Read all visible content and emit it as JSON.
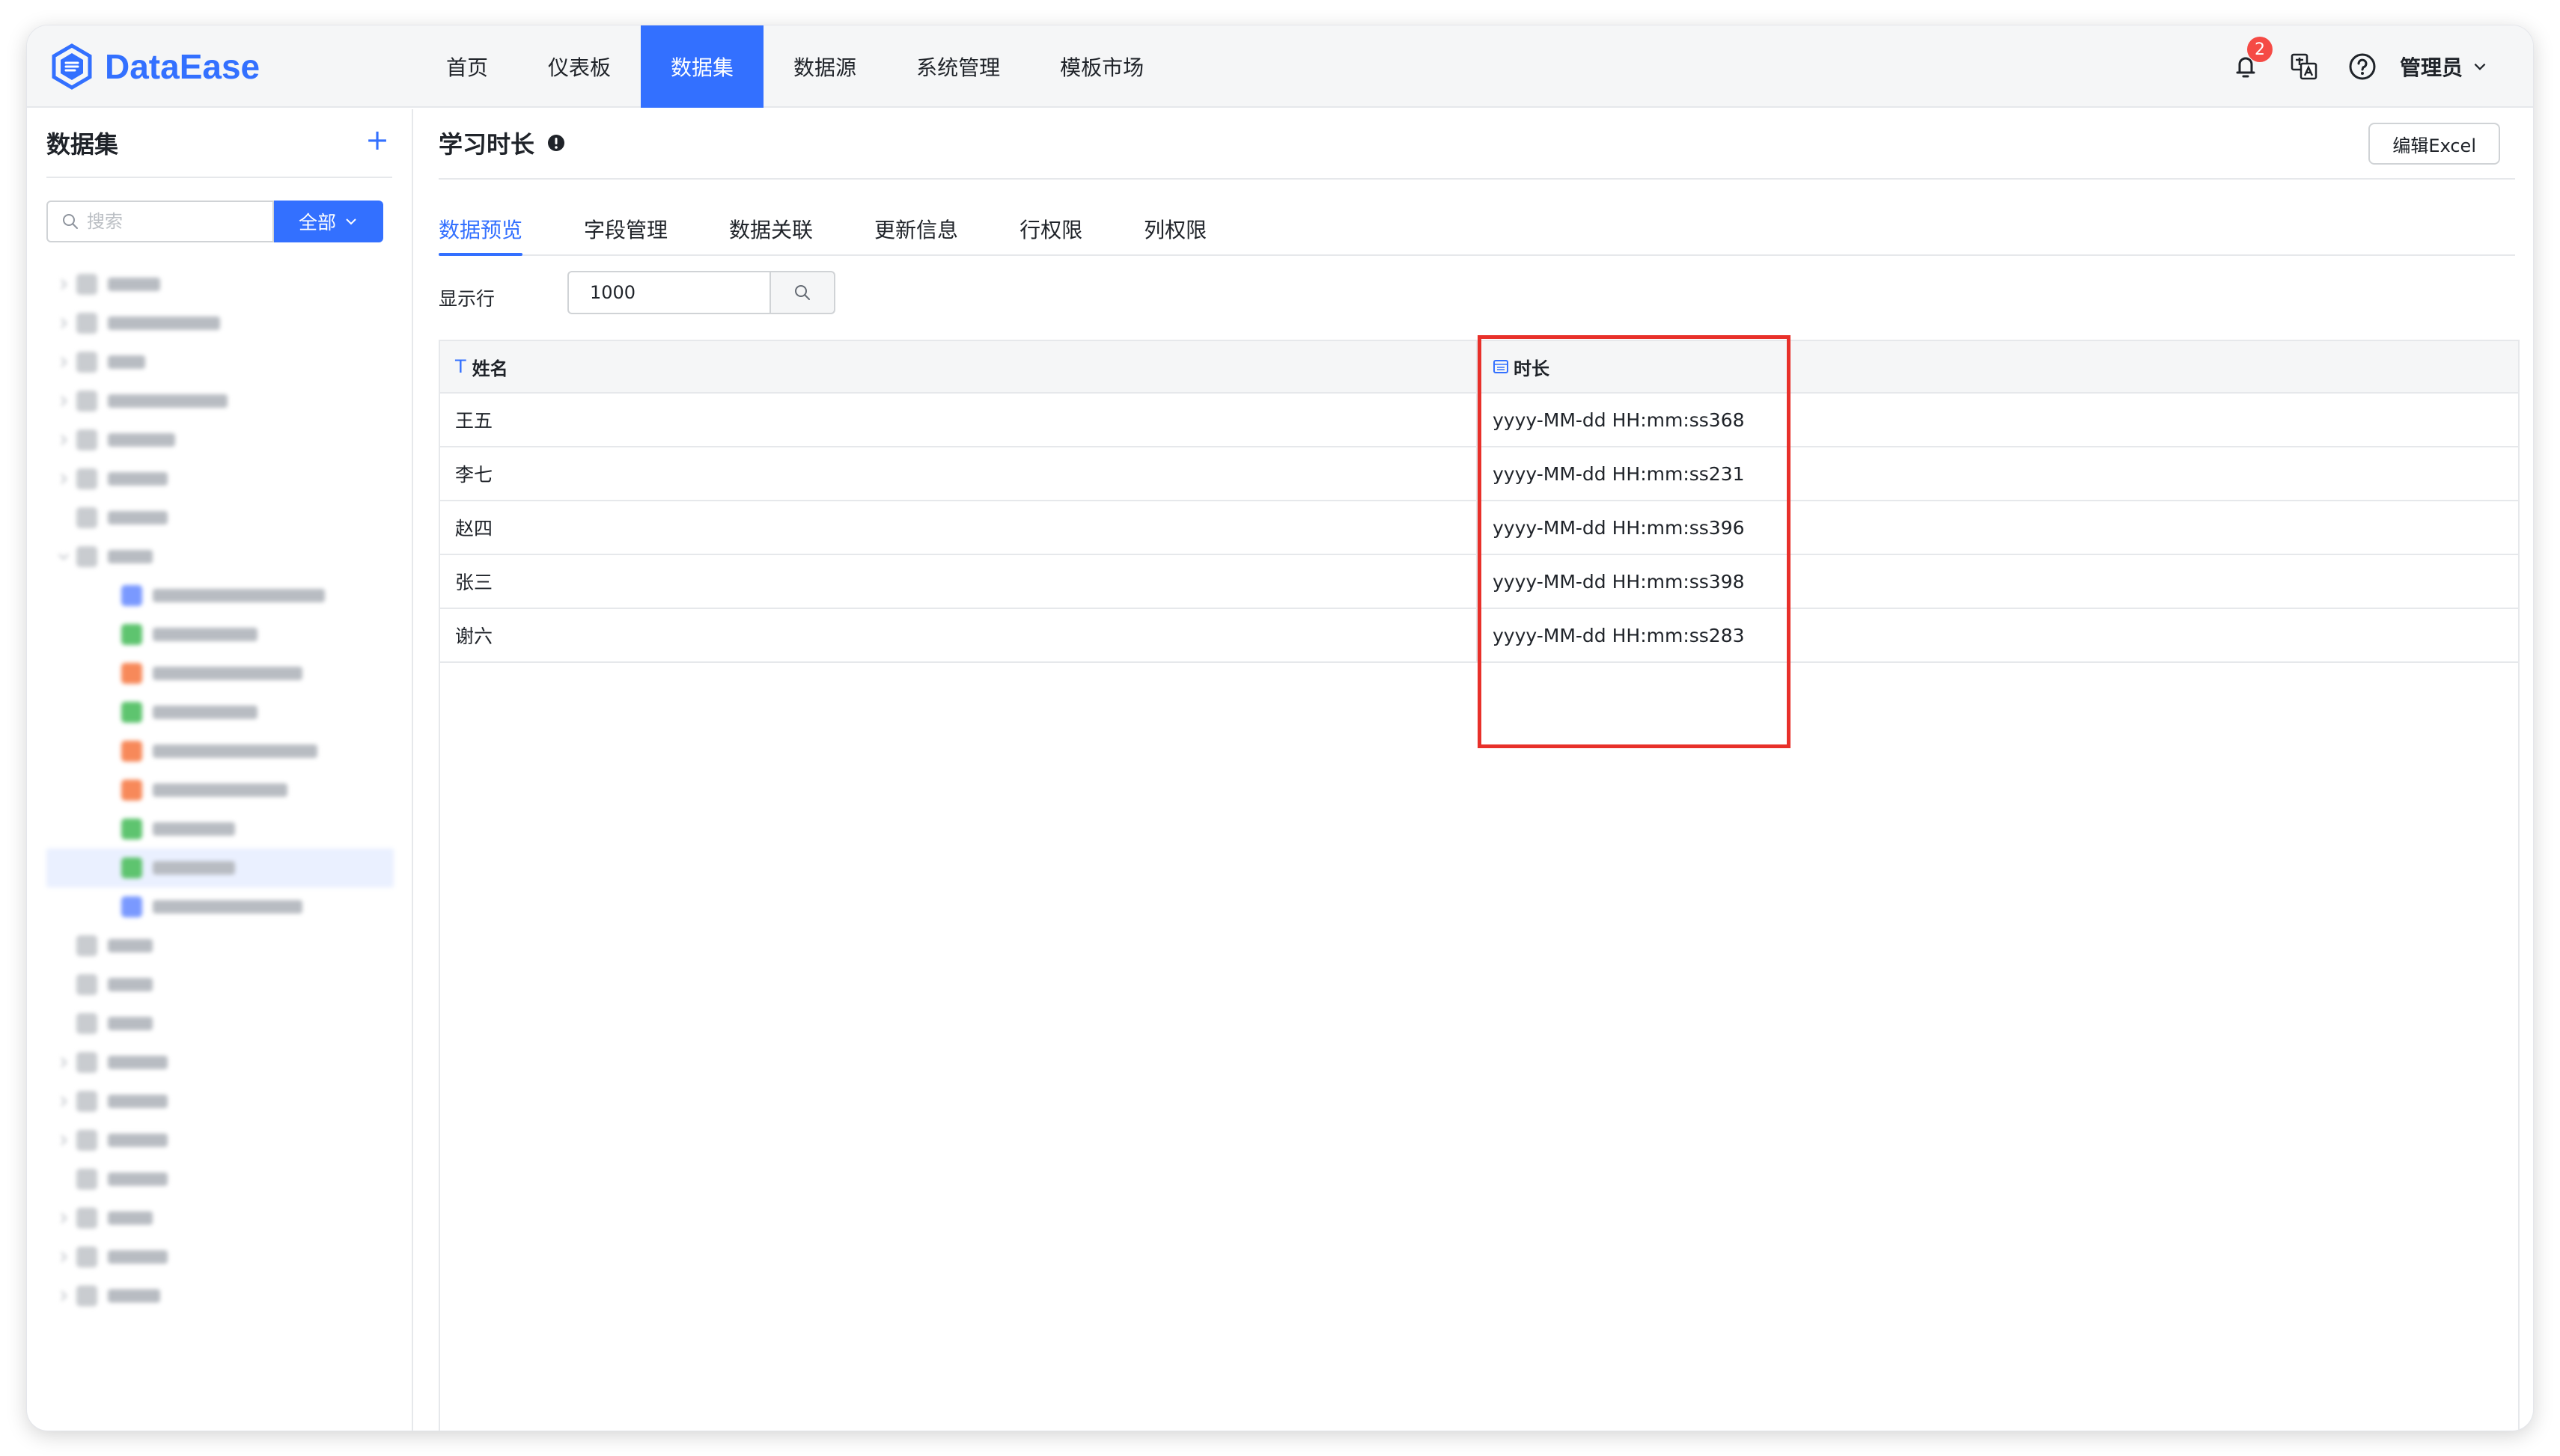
{
  "app": {
    "brand": "DataEase",
    "brand_color": "#3370ff"
  },
  "nav": {
    "items": [
      {
        "label": "首页"
      },
      {
        "label": "仪表板"
      },
      {
        "label": "数据集",
        "active": true
      },
      {
        "label": "数据源"
      },
      {
        "label": "系统管理"
      },
      {
        "label": "模板市场"
      }
    ]
  },
  "header_right": {
    "notification_icon": "bell-icon",
    "notification_count": "2",
    "language_icon": "translate-icon",
    "help_icon": "question-circle-icon",
    "user_name": "管理员"
  },
  "sidebar": {
    "title": "数据集",
    "add_label": "+",
    "search_placeholder": "搜索",
    "filter_label": "全部"
  },
  "main": {
    "title": "学习时长",
    "info_icon": "info-circle-icon",
    "edit_button": "编辑Excel",
    "tabs": [
      {
        "label": "数据预览",
        "active": true
      },
      {
        "label": "字段管理"
      },
      {
        "label": "数据关联"
      },
      {
        "label": "更新信息"
      },
      {
        "label": "行权限"
      },
      {
        "label": "列权限"
      }
    ],
    "rows_label": "显示行",
    "rows_value": "1000"
  },
  "table": {
    "columns": [
      {
        "type_marker": "T",
        "name": "姓名"
      },
      {
        "type_marker": "calendar-icon",
        "name": "时长"
      }
    ],
    "rows": [
      [
        "王五",
        "yyyy-MM-dd HH:mm:ss368"
      ],
      [
        "李七",
        "yyyy-MM-dd HH:mm:ss231"
      ],
      [
        "赵四",
        "yyyy-MM-dd HH:mm:ss396"
      ],
      [
        "张三",
        "yyyy-MM-dd HH:mm:ss398"
      ],
      [
        "谢六",
        "yyyy-MM-dd HH:mm:ss283"
      ]
    ]
  },
  "annotation": {
    "highlight_color": "#e8302a"
  }
}
